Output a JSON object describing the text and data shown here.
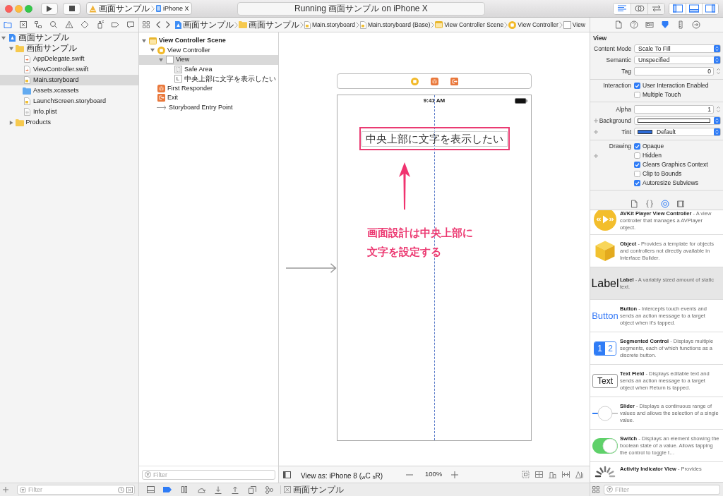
{
  "toolbar": {
    "scheme": {
      "target": "画面サンプル",
      "device": "iPhone X"
    },
    "activity": "Running 画面サンプル on iPhone X",
    "editor_modes": [
      {
        "kind": "standard",
        "selected": true
      },
      {
        "kind": "assistant",
        "selected": false
      },
      {
        "kind": "version",
        "selected": false
      }
    ],
    "panels": [
      {
        "kind": "navigator",
        "on": true
      },
      {
        "kind": "debug",
        "on": true
      },
      {
        "kind": "inspector",
        "on": true
      }
    ]
  },
  "navigator_tabs": [
    {
      "kind": "project",
      "selected": true
    },
    {
      "kind": "source_control",
      "selected": false
    },
    {
      "kind": "symbol",
      "selected": false
    },
    {
      "kind": "find",
      "selected": false
    },
    {
      "kind": "issue",
      "selected": false
    },
    {
      "kind": "test",
      "selected": false
    },
    {
      "kind": "debug",
      "selected": false
    },
    {
      "kind": "breakpoint",
      "selected": false
    },
    {
      "kind": "report",
      "selected": false
    }
  ],
  "jump_bar": [
    {
      "kind": "project",
      "label": "画面サンプル"
    },
    {
      "kind": "folder",
      "label": "画面サンプル"
    },
    {
      "kind": "storyboard",
      "label": "Main.storyboard"
    },
    {
      "kind": "storyboard",
      "label": "Main.storyboard (Base)"
    },
    {
      "kind": "scene",
      "label": "View Controller Scene"
    },
    {
      "kind": "controller",
      "label": "View Controller"
    },
    {
      "kind": "view",
      "label": "View"
    }
  ],
  "inspector_tabs": [
    {
      "kind": "file",
      "selected": false
    },
    {
      "kind": "help",
      "selected": false
    },
    {
      "kind": "identity",
      "selected": false
    },
    {
      "kind": "attributes",
      "selected": true
    },
    {
      "kind": "size",
      "selected": false
    },
    {
      "kind": "connections",
      "selected": false
    }
  ],
  "navigator": {
    "tree": [
      {
        "kind": "project",
        "label": "画面サンプル",
        "expanded": true,
        "selected": false,
        "children": [
          {
            "kind": "folder",
            "label": "画面サンプル",
            "expanded": true,
            "selected": false,
            "children": [
              {
                "kind": "swift",
                "label": "AppDelegate.swift",
                "selected": false
              },
              {
                "kind": "swift",
                "label": "ViewController.swift",
                "selected": false
              },
              {
                "kind": "storyboard",
                "label": "Main.storyboard",
                "selected": true
              },
              {
                "kind": "assets",
                "label": "Assets.xcassets",
                "selected": false
              },
              {
                "kind": "storyboard",
                "label": "LaunchScreen.storyboard",
                "selected": false
              },
              {
                "kind": "plist",
                "label": "Info.plist",
                "selected": false
              }
            ]
          },
          {
            "kind": "folder",
            "label": "Products",
            "expanded": false,
            "selected": false
          }
        ]
      }
    ],
    "filter": {
      "placeholder": "Filter"
    }
  },
  "outline": {
    "tree": [
      {
        "kind": "scene",
        "label": "View Controller Scene",
        "expanded": true,
        "selected": false,
        "children": [
          {
            "kind": "controller",
            "label": "View Controller",
            "expanded": true,
            "selected": false,
            "children": [
              {
                "kind": "view",
                "label": "View",
                "expanded": true,
                "selected": true,
                "children": [
                  {
                    "kind": "safe_area",
                    "label": "Safe Area",
                    "selected": false
                  },
                  {
                    "kind": "label",
                    "icon_letter": "L",
                    "label": "中央上部に文字を表示したい",
                    "selected": false
                  }
                ]
              }
            ]
          },
          {
            "kind": "responder",
            "label": "First Responder",
            "selected": false
          },
          {
            "kind": "exit",
            "label": "Exit",
            "selected": false
          },
          {
            "kind": "entry",
            "label": "Storyboard Entry Point",
            "selected": false
          }
        ]
      }
    ],
    "filter": {
      "placeholder": "Filter"
    }
  },
  "canvas": {
    "dock": [
      {
        "kind": "controller"
      },
      {
        "kind": "responder"
      },
      {
        "kind": "exit"
      }
    ],
    "status_time": "9:41 AM",
    "label_text": "中央上部に文字を表示したい",
    "annotation_lines": [
      "画面設計は中央上部に",
      "文字を設定する"
    ]
  },
  "canvas_bar": {
    "view_as": "View as: iPhone 8 ($_{w}$C $_{h}$R)",
    "zoom": "100%"
  },
  "debug_bar": {
    "breakpoints_active": true,
    "target": "画面サンプル"
  },
  "inspector": {
    "title": "View",
    "groups": [
      [
        {
          "kind": "popup",
          "label": "Content Mode",
          "value": "Scale To Fill",
          "variation": false
        },
        {
          "kind": "popup",
          "label": "Semantic",
          "value": "Unspecified",
          "variation": false
        },
        {
          "kind": "number",
          "label": "Tag",
          "value": "0",
          "variation": false
        }
      ],
      [
        {
          "kind": "checkbox",
          "label": "Interaction",
          "text": "User Interaction Enabled",
          "checked": true,
          "variation": false
        },
        {
          "kind": "checkbox",
          "text": "Multiple Touch",
          "checked": false,
          "variation": false
        }
      ],
      [
        {
          "kind": "number",
          "label": "Alpha",
          "value": "1",
          "variation": false
        },
        {
          "kind": "color",
          "label": "Background",
          "color": "#ffffff",
          "variation": true
        },
        {
          "kind": "color",
          "label": "Tint",
          "color": "#2c6bd8",
          "value": "Default",
          "variation": true
        }
      ],
      [
        {
          "kind": "checkbox",
          "label": "Drawing",
          "text": "Opaque",
          "checked": true,
          "variation": false
        },
        {
          "kind": "checkbox",
          "text": "Hidden",
          "checked": false,
          "variation": true
        },
        {
          "kind": "checkbox",
          "text": "Clears Graphics Context",
          "checked": true,
          "variation": false
        },
        {
          "kind": "checkbox",
          "text": "Clip to Bounds",
          "checked": false,
          "variation": false
        },
        {
          "kind": "checkbox",
          "text": "Autoresize Subviews",
          "checked": true,
          "variation": false
        }
      ]
    ]
  },
  "library": {
    "tabs": [
      {
        "kind": "file",
        "selected": false
      },
      {
        "kind": "code",
        "selected": false
      },
      {
        "kind": "object",
        "selected": true
      },
      {
        "kind": "media",
        "selected": false
      }
    ],
    "items": [
      {
        "kind": "avplayer",
        "text": "**AVKit Player View Controller** - A view controller that manages a AVPlayer object.",
        "selected": false
      },
      {
        "kind": "object",
        "text": "**Object** - Provides a template for objects and controllers not directly available in Interface Builder.",
        "selected": false
      },
      {
        "kind": "label",
        "preview": "Label",
        "text": "**Label** - A variably sized amount of static text.",
        "selected": true
      },
      {
        "kind": "button",
        "preview": "Button",
        "text": "**Button** - Intercepts touch events and sends an action message to a target object when it's tapped.",
        "selected": false
      },
      {
        "kind": "segmented",
        "preview": [
          "1",
          "2"
        ],
        "text": "**Segmented Control** - Displays multiple segments, each of which functions as a discrete button.",
        "selected": false
      },
      {
        "kind": "textfield",
        "preview": "Text",
        "text": "**Text Field** - Displays editable text and sends an action message to a target object when Return is tapped.",
        "selected": false
      },
      {
        "kind": "slider",
        "text": "**Slider** - Displays a continuous range of values and allows the selection of a single value.",
        "selected": false
      },
      {
        "kind": "switch",
        "text": "**Switch** - Displays an element showing the boolean state of a value. Allows tapping the control to toggle t…",
        "selected": false
      },
      {
        "kind": "activity",
        "text": "**Activity Indicator View** - Provides",
        "selected": false
      }
    ],
    "filter": {
      "placeholder": "Filter"
    }
  }
}
